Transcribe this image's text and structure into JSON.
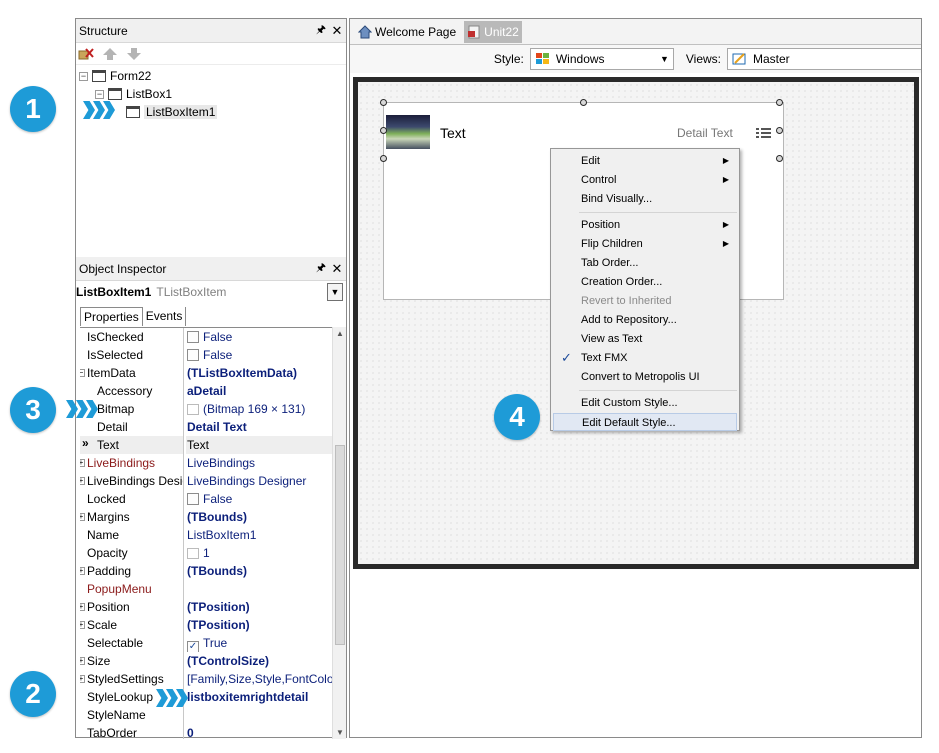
{
  "structure_panel": {
    "title": "Structure",
    "tree": [
      {
        "label": "Form22"
      },
      {
        "label": "ListBox1"
      },
      {
        "label": "ListBoxItem1"
      }
    ]
  },
  "object_inspector": {
    "title": "Object Inspector",
    "selected_name": "ListBoxItem1",
    "selected_type": "TListBoxItem",
    "tabs": [
      "Properties",
      "Events"
    ],
    "properties": [
      {
        "key": "IsChecked",
        "value": "False",
        "kind": "check"
      },
      {
        "key": "IsSelected",
        "value": "False",
        "kind": "check"
      },
      {
        "key": "ItemData",
        "value": "(TListBoxItemData)",
        "kind": "bold",
        "expander": "−"
      },
      {
        "key": "Accessory",
        "value": "aDetail",
        "kind": "bold",
        "indent": true
      },
      {
        "key": "Bitmap",
        "value": "(Bitmap 169 × 131)",
        "kind": "bitmap",
        "indent": true
      },
      {
        "key": "Detail",
        "value": "Detail Text",
        "kind": "bold",
        "indent": true
      },
      {
        "key": "Text",
        "value": "Text",
        "kind": "plain",
        "indent": true,
        "current": true
      },
      {
        "key": "LiveBindings",
        "value": "LiveBindings",
        "kind": "blue",
        "red": true,
        "expander": "+"
      },
      {
        "key": "LiveBindings Designer",
        "value": "LiveBindings Designer",
        "kind": "blue",
        "expander": "+"
      },
      {
        "key": "Locked",
        "value": "False",
        "kind": "check"
      },
      {
        "key": "Margins",
        "value": "(TBounds)",
        "kind": "bold",
        "expander": "+"
      },
      {
        "key": "Name",
        "value": "ListBoxItem1",
        "kind": "blue"
      },
      {
        "key": "Opacity",
        "value": "1",
        "kind": "opacity"
      },
      {
        "key": "Padding",
        "value": "(TBounds)",
        "kind": "bold",
        "expander": "+"
      },
      {
        "key": "PopupMenu",
        "value": "",
        "kind": "plain",
        "red": true
      },
      {
        "key": "Position",
        "value": "(TPosition)",
        "kind": "bold",
        "expander": "+"
      },
      {
        "key": "Scale",
        "value": "(TPosition)",
        "kind": "bold",
        "expander": "+"
      },
      {
        "key": "Selectable",
        "value": "True",
        "kind": "checked"
      },
      {
        "key": "Size",
        "value": "(TControlSize)",
        "kind": "bold",
        "expander": "+"
      },
      {
        "key": "StyledSettings",
        "value": "[Family,Size,Style,FontColor]",
        "kind": "blue",
        "expander": "+"
      },
      {
        "key": "StyleLookup",
        "value": "listboxitemrightdetail",
        "kind": "bold"
      },
      {
        "key": "StyleName",
        "value": "",
        "kind": "plain"
      },
      {
        "key": "TabOrder",
        "value": "0",
        "kind": "bold"
      }
    ]
  },
  "editor": {
    "tabs": [
      "Welcome Page",
      "Unit22"
    ],
    "style_label": "Style:",
    "style_value": "Windows",
    "views_label": "Views:",
    "views_value": "Master"
  },
  "designer": {
    "item_text": "Text",
    "item_detail": "Detail Text"
  },
  "context_menu": {
    "items": [
      {
        "label": "Edit",
        "submenu": true
      },
      {
        "label": "Control",
        "submenu": true
      },
      {
        "label": "Bind Visually..."
      },
      {
        "sep": true
      },
      {
        "label": "Position",
        "submenu": true
      },
      {
        "label": "Flip Children",
        "submenu": true
      },
      {
        "label": "Tab Order..."
      },
      {
        "label": "Creation Order..."
      },
      {
        "label": "Revert to Inherited",
        "disabled": true
      },
      {
        "label": "Add to Repository..."
      },
      {
        "label": "View as Text"
      },
      {
        "label": "Text FMX",
        "checked": true
      },
      {
        "label": "Convert to Metropolis UI"
      },
      {
        "sep": true
      },
      {
        "label": "Edit Custom Style..."
      },
      {
        "label": "Edit Default Style...",
        "hover": true
      }
    ]
  },
  "callouts": [
    "1",
    "2",
    "3",
    "4"
  ],
  "colors": {
    "accent": "#1e9bd7",
    "value_blue": "#0b1f7a",
    "key_red": "#8b1a1a"
  },
  "icons": [
    "pin-icon",
    "close-icon",
    "delete-icon",
    "arrow-up-icon",
    "arrow-down-icon",
    "form-icon",
    "home-icon",
    "unit-file-icon",
    "windows-logo-icon",
    "master-view-icon",
    "check-icon",
    "chevron-right-icon",
    "accessory-detail-icon"
  ]
}
